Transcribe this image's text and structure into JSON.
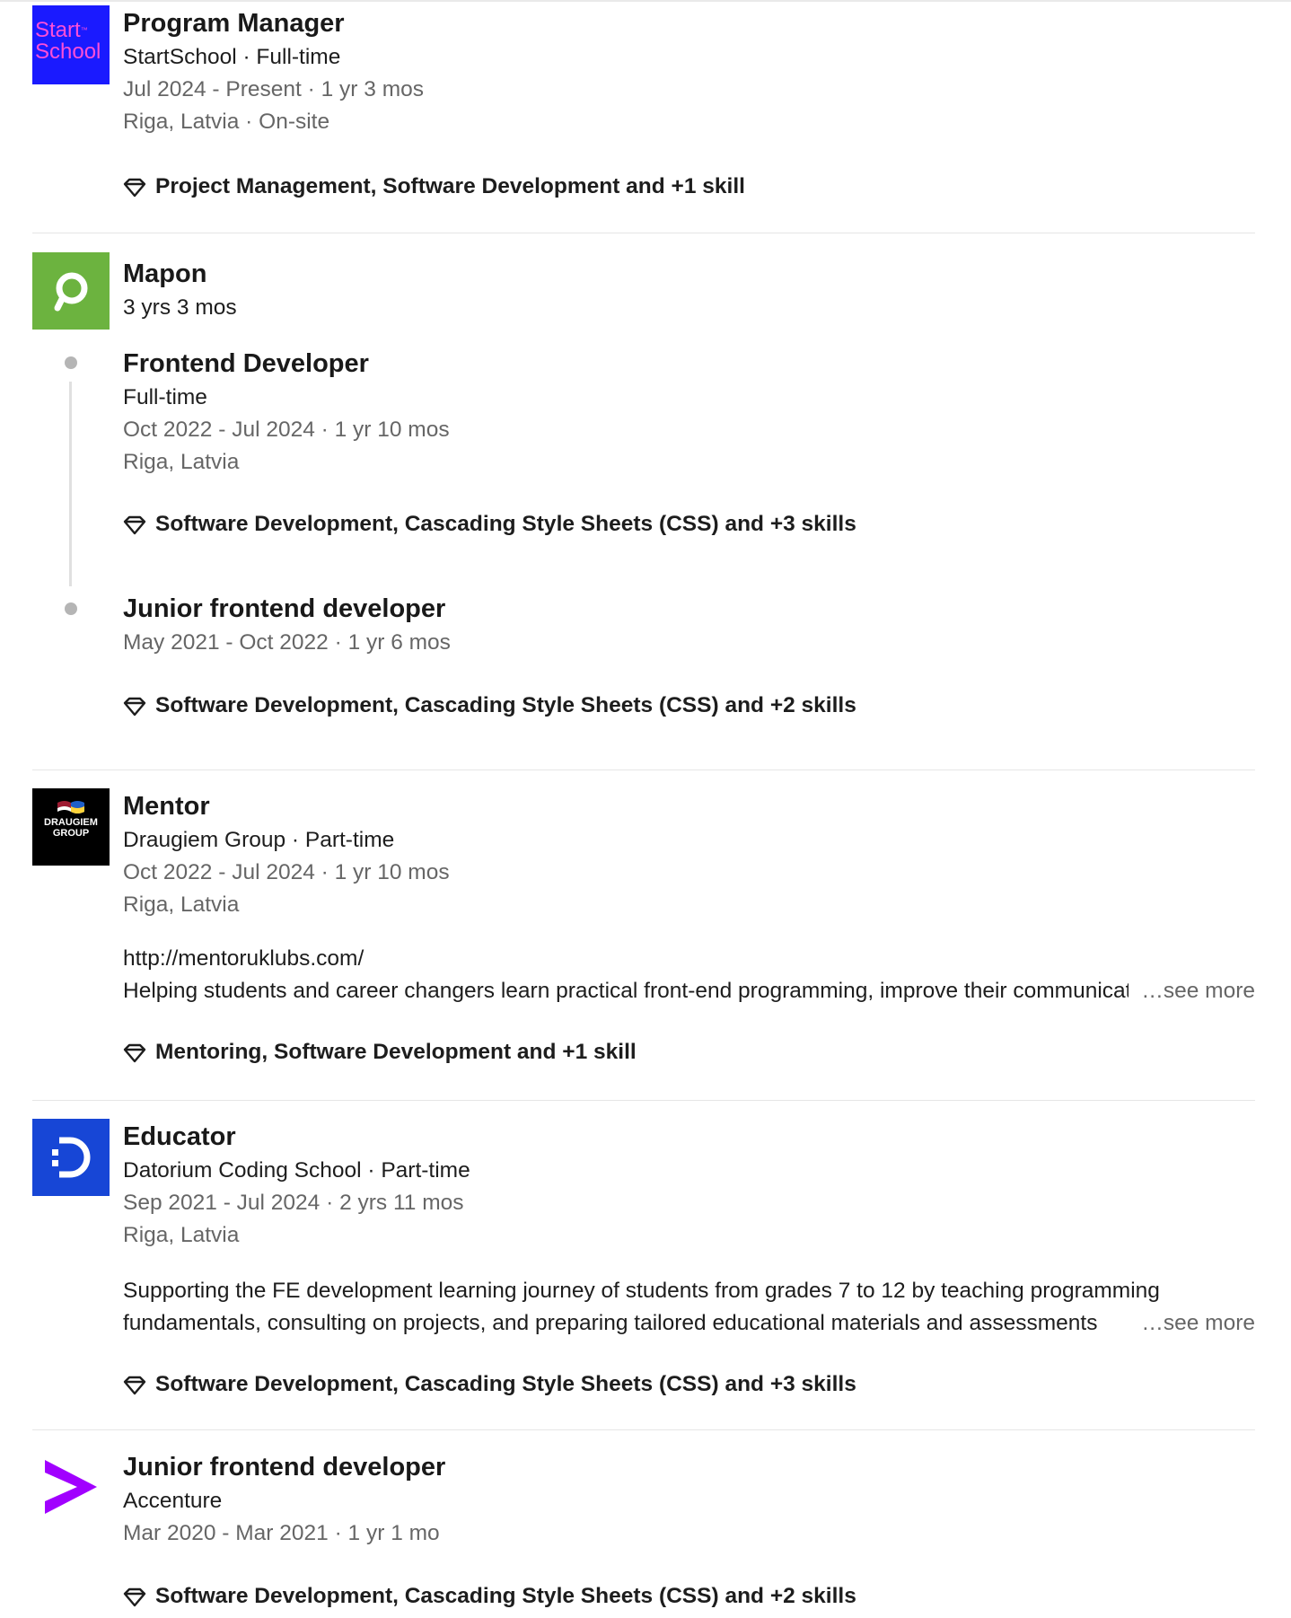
{
  "entries": {
    "startschool": {
      "logo_line1": "Start",
      "logo_tm": "™",
      "logo_line2": "School",
      "title": "Program Manager",
      "company_line": "StartSchool · Full-time",
      "dates": "Jul 2024 - Present · 1 yr 3 mos",
      "location": "Riga, Latvia · On-site",
      "skills": "Project Management, Software Development and +1 skill"
    },
    "mapon": {
      "company": "Mapon",
      "duration": "3 yrs 3 mos",
      "roles": [
        {
          "title": "Frontend Developer",
          "type": "Full-time",
          "dates": "Oct 2022 - Jul 2024 · 1 yr 10 mos",
          "location": "Riga, Latvia",
          "skills": "Software Development, Cascading Style Sheets (CSS) and +3 skills"
        },
        {
          "title": "Junior frontend developer",
          "dates": "May 2021 - Oct 2022 · 1 yr 6 mos",
          "skills": "Software Development, Cascading Style Sheets (CSS) and +2 skills"
        }
      ]
    },
    "draugiem": {
      "logo_text_1": "DRAUGIEM",
      "logo_text_2": "GROUP",
      "title": "Mentor",
      "company_line": "Draugiem Group · Part-time",
      "dates": "Oct 2022 - Jul 2024 · 1 yr 10 mos",
      "location": "Riga, Latvia",
      "link": "http://mentoruklubs.com/",
      "description": "Helping students and career changers learn practical front-end programming, improve their communication",
      "see_more": "…see more",
      "skills": "Mentoring, Software Development and +1 skill"
    },
    "datorium": {
      "title": "Educator",
      "company_line": "Datorium Coding School · Part-time",
      "dates": "Sep 2021 - Jul 2024 · 2 yrs 11 mos",
      "location": "Riga, Latvia",
      "description_1": "Supporting the FE development learning journey of students from grades 7 to 12 by teaching programming",
      "description_2": "fundamentals, consulting on projects, and preparing tailored educational materials and assessments",
      "see_more": "…see more",
      "skills": "Software Development, Cascading Style Sheets (CSS) and +3 skills"
    },
    "accenture": {
      "title": "Junior frontend developer",
      "company": "Accenture",
      "dates": "Mar 2020 - Mar 2021 · 1 yr 1 mo",
      "skills": "Software Development, Cascading Style Sheets (CSS) and +2 skills"
    }
  },
  "colors": {
    "startschool_bg": "#1a1aff",
    "startschool_text": "#ff4fd8",
    "mapon_bg": "#6cb33f",
    "draugiem_bg": "#000000",
    "datorium_bg": "#1746d6",
    "accenture_purple": "#a100ff",
    "muted_text": "#666666",
    "divider": "#e6e6e6"
  },
  "icons": {
    "skills": "diamond-icon",
    "mapon_logo": "magnifier-pin-icon",
    "datorium_logo": "d-logo-icon",
    "accenture_logo": "greater-than-icon"
  }
}
